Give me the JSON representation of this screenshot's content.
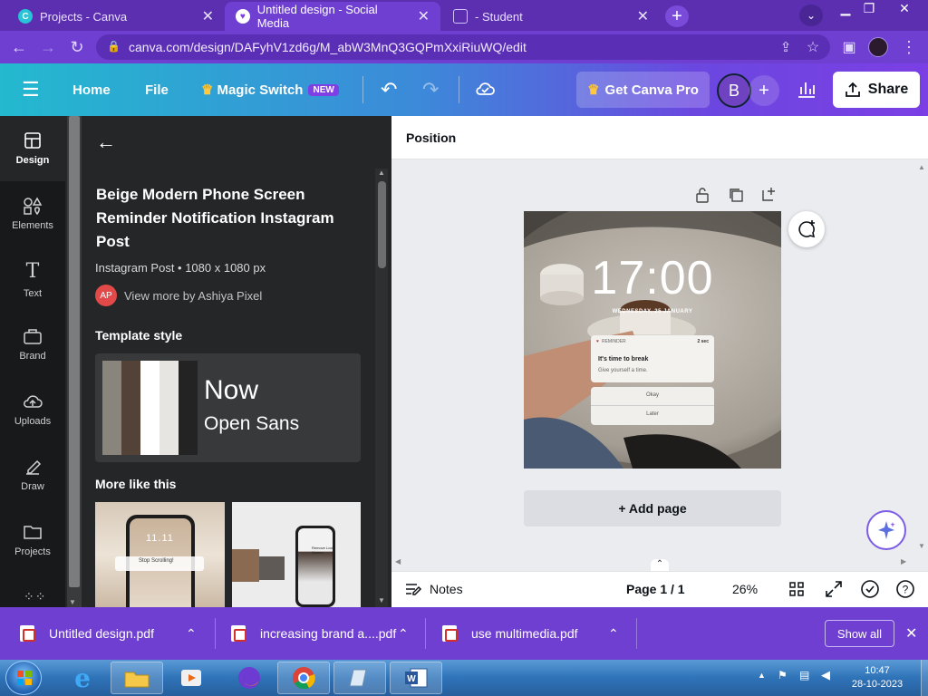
{
  "browser": {
    "tabs": [
      {
        "title": "Projects - Canva",
        "active": false,
        "icon": "canva-icon"
      },
      {
        "title": "Untitled design - Social Media",
        "active": true,
        "icon": "heart-icon"
      },
      {
        "title": "- Student",
        "active": false,
        "icon": "student-icon"
      }
    ],
    "url": "canva.com/design/DAFyhV1zd6g/M_abW3MnQ3GQPmXxiRiuWQ/edit"
  },
  "header": {
    "home": "Home",
    "file": "File",
    "magic_switch": "Magic Switch",
    "new_badge": "NEW",
    "get_pro": "Get Canva Pro",
    "avatar_letter": "B",
    "share": "Share"
  },
  "rail": {
    "items": [
      {
        "label": "Design",
        "icon": "design-icon"
      },
      {
        "label": "Elements",
        "icon": "elements-icon"
      },
      {
        "label": "Text",
        "icon": "text-icon"
      },
      {
        "label": "Brand",
        "icon": "brand-icon"
      },
      {
        "label": "Uploads",
        "icon": "upload-icon"
      },
      {
        "label": "Draw",
        "icon": "draw-icon"
      },
      {
        "label": "Projects",
        "icon": "folder-icon"
      }
    ]
  },
  "panel": {
    "template_title": "Beige Modern Phone Screen Reminder Notification Instagram Post",
    "template_meta": "Instagram Post • 1080 x 1080 px",
    "author_initials": "AP",
    "author_link": "View more by Ashiya Pixel",
    "template_style_heading": "Template style",
    "font_heading": "Now",
    "font_body": "Open Sans",
    "swatches": [
      "#8a857c",
      "#524238",
      "#ffffff",
      "#e7e5e2",
      "#232323"
    ],
    "more_heading": "More like this",
    "thumb1": {
      "time": "11.11",
      "line": "Stop Scrolling!"
    },
    "thumb2": {
      "label": "Remove Lock Screen"
    }
  },
  "editor": {
    "position_label": "Position",
    "design": {
      "time": "17:00",
      "date": "WEDNESDAY, 25 JANUARY",
      "notif_app": "REMINDER",
      "notif_age": "2 sec",
      "notif_title": "It's time to break",
      "notif_body": "Give yourself a time.",
      "button_okay": "Okay",
      "button_later": "Later"
    },
    "add_page": "+ Add page"
  },
  "bottom": {
    "notes": "Notes",
    "page": "Page 1 / 1",
    "zoom": "26%"
  },
  "downloads": {
    "files": [
      "Untitled design.pdf",
      "increasing brand a....pdf",
      "use multimedia.pdf"
    ],
    "show_all": "Show all"
  },
  "taskbar": {
    "time": "10:47",
    "date": "28-10-2023"
  }
}
